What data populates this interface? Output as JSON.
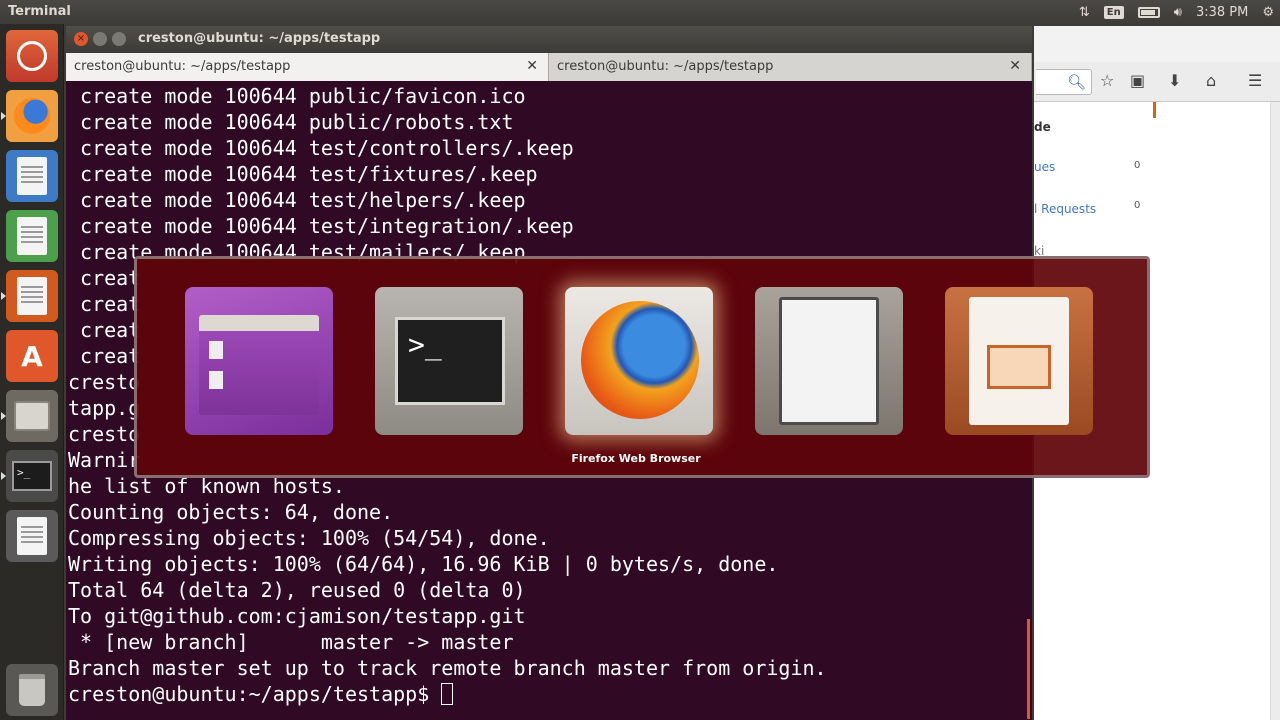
{
  "top_panel": {
    "app_title": "Terminal",
    "keyboard_layout": "En",
    "clock": "3:38 PM",
    "icons": [
      "network-icon",
      "keyboard-icon",
      "battery-icon",
      "volume-icon",
      "settings-icon"
    ]
  },
  "launcher": {
    "items": [
      "ubuntu-dash",
      "firefox",
      "libreoffice-writer",
      "libreoffice-calc",
      "libreoffice-impress",
      "ubuntu-software-center",
      "files",
      "terminal",
      "libreoffice",
      "trash"
    ],
    "software_glyph": "A",
    "terminal_glyph": ">_"
  },
  "terminal": {
    "window_title": "creston@ubuntu: ~/apps/testapp",
    "tabs": [
      {
        "label": "creston@ubuntu: ~/apps/testapp"
      },
      {
        "label": "creston@ubuntu: ~/apps/testapp"
      }
    ],
    "lines": [
      " create mode 100644 public/favicon.ico",
      " create mode 100644 public/robots.txt",
      " create mode 100644 test/controllers/.keep",
      " create mode 100644 test/fixtures/.keep",
      " create mode 100644 test/helpers/.keep",
      " create mode 100644 test/integration/.keep",
      " create mode 100644 test/mailers/.keep",
      " creat",
      " creat",
      " creat",
      " creat",
      "cresto",
      "tapp.g",
      "cresto",
      "Warnir",
      "he list of known hosts.",
      "Counting objects: 64, done.",
      "Compressing objects: 100% (54/54), done.",
      "Writing objects: 100% (64/64), 16.96 KiB | 0 bytes/s, done.",
      "Total 64 (delta 2), reused 0 (delta 0)",
      "To git@github.com:cjamison/testapp.git",
      " * [new branch]      master -> master",
      "Branch master set up to track remote branch master from origin.",
      "creston@ubuntu:~/apps/testapp$ "
    ]
  },
  "firefox_behind": {
    "partial_texts": [
      "de",
      "ues",
      "l Requests",
      "ki"
    ],
    "counts": [
      "0",
      "0"
    ]
  },
  "switcher": {
    "apps": [
      "Files",
      "Terminal",
      "Firefox Web Browser",
      "LibreOffice",
      "LibreOffice Impress"
    ],
    "selected_label": "Firefox Web Browser",
    "terminal_prompt_glyph": ">_"
  }
}
